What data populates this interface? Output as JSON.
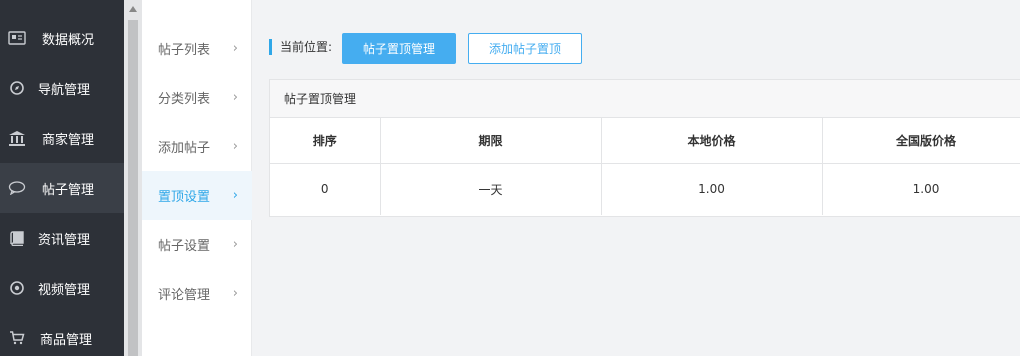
{
  "sidebar": {
    "items": [
      {
        "label": "数据概况",
        "icon": "dashboard-icon"
      },
      {
        "label": "导航管理",
        "icon": "compass-icon"
      },
      {
        "label": "商家管理",
        "icon": "bank-icon"
      },
      {
        "label": "帖子管理",
        "icon": "chat-bubble-icon"
      },
      {
        "label": "资讯管理",
        "icon": "book-icon"
      },
      {
        "label": "视频管理",
        "icon": "play-circle-icon"
      },
      {
        "label": "商品管理",
        "icon": "cart-icon"
      }
    ],
    "active_index": 3
  },
  "submenu": {
    "items": [
      {
        "label": "帖子列表"
      },
      {
        "label": "分类列表"
      },
      {
        "label": "添加帖子"
      },
      {
        "label": "置顶设置"
      },
      {
        "label": "帖子设置"
      },
      {
        "label": "评论管理"
      }
    ],
    "active_index": 3,
    "chevron": "›"
  },
  "main": {
    "crumb_label": "当前位置:",
    "primary_button": "帖子置顶管理",
    "outline_button": "添加帖子置顶",
    "panel_title": "帖子置顶管理",
    "table": {
      "headers": [
        "排序",
        "期限",
        "本地价格",
        "全国版价格"
      ],
      "rows": [
        [
          "0",
          "一天",
          "1.00",
          "1.00"
        ]
      ]
    }
  },
  "colors": {
    "accent": "#45adf0",
    "sidebar_bg": "#2d3138",
    "active_sub_bg": "#eef6fc"
  }
}
